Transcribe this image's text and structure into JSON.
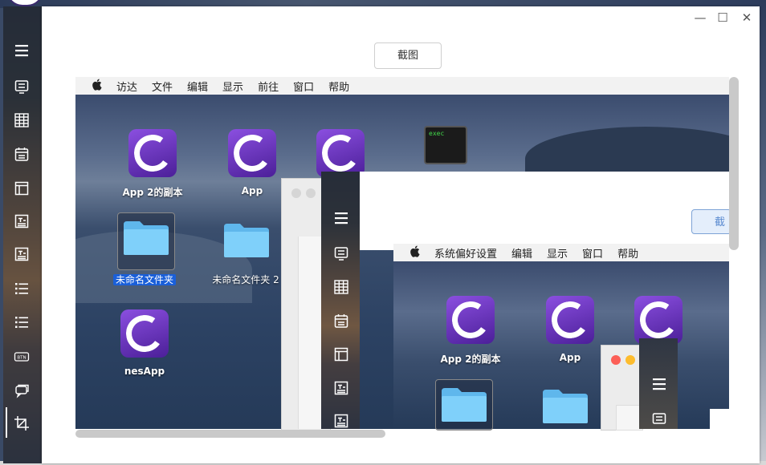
{
  "window": {
    "controls": {
      "minimize": "—",
      "maximize": "☐",
      "close": "✕"
    },
    "screenshot_button": "截图"
  },
  "sidebar": {
    "items": [
      {
        "icon": "menu-icon"
      },
      {
        "icon": "form-icon"
      },
      {
        "icon": "table-icon"
      },
      {
        "icon": "calendar-icon"
      },
      {
        "icon": "layout-icon"
      },
      {
        "icon": "text-box-icon"
      },
      {
        "icon": "text-box-icon-2"
      },
      {
        "icon": "list-icon"
      },
      {
        "icon": "list-icon-2"
      },
      {
        "icon": "btn-icon",
        "text": "BTN"
      },
      {
        "icon": "chat-icon"
      },
      {
        "icon": "crop-icon"
      }
    ]
  },
  "screen": {
    "menubar": {
      "apple": "",
      "items": [
        "访达",
        "文件",
        "编辑",
        "显示",
        "前往",
        "窗口",
        "帮助"
      ]
    },
    "desktop": {
      "apps": [
        {
          "label": "App 2的副本"
        },
        {
          "label": "App"
        },
        {
          "label": "nesApp"
        }
      ],
      "folders": [
        {
          "label": "未命名文件夹",
          "selected": true
        },
        {
          "label": "未命名文件夹 2"
        }
      ],
      "exec": {
        "text": "exec"
      }
    },
    "nested": {
      "button": "截图",
      "menubar": {
        "items": [
          "系统偏好设置",
          "编辑",
          "显示",
          "窗口",
          "帮助"
        ]
      },
      "apps": [
        {
          "label": "App 2的副本"
        },
        {
          "label": "App"
        }
      ]
    }
  },
  "colors": {
    "accent": "#1a5fd9",
    "app_icon": "#6a32c4",
    "folder": "#6ec6f5"
  }
}
